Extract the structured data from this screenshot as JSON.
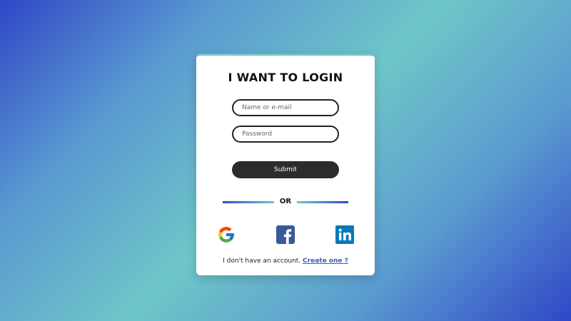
{
  "login": {
    "title": "I WANT TO LOGIN",
    "name_placeholder": "Name or e-mail",
    "password_placeholder": "Password",
    "submit_label": "Submit",
    "divider_text": "OR",
    "social": [
      {
        "name": "google-icon"
      },
      {
        "name": "facebook-icon"
      },
      {
        "name": "linkedin-icon"
      }
    ],
    "footer_text": "I don't have an account.",
    "create_link": "Create one ?"
  },
  "colors": {
    "accent": "#3a5fb0",
    "button_bg": "#2c2c2c",
    "gradient_blue": "#3047c8",
    "gradient_teal": "#6ec6c8"
  }
}
